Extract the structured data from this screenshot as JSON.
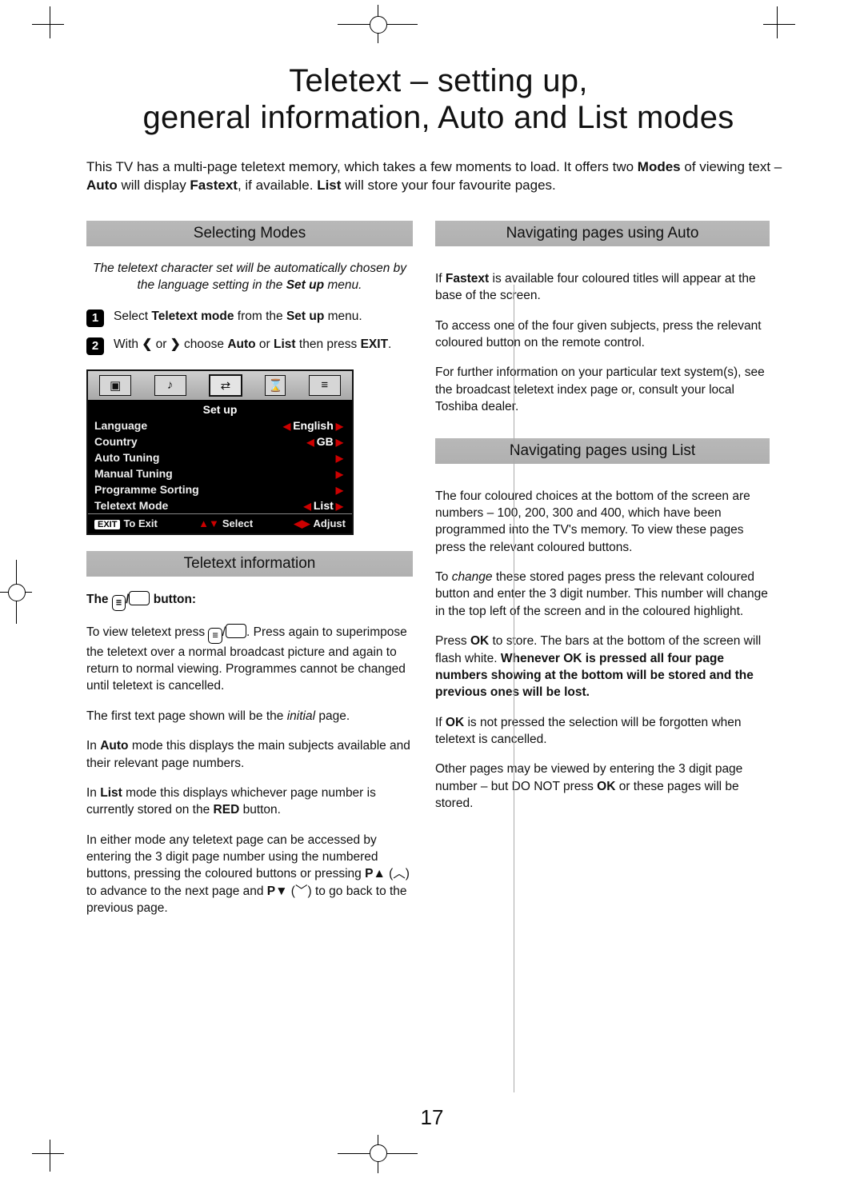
{
  "title_line1": "Teletext – setting up,",
  "title_line2": "general information, Auto and List modes",
  "intro_pre": "This TV has a multi-page teletext memory, which takes a few moments to load. It offers two ",
  "intro_modes_word": "Modes",
  "intro_post": " of viewing text – ",
  "intro_auto": "Auto",
  "intro_mid": " will display ",
  "intro_fastext": "Fastext",
  "intro_after": ", if available. ",
  "intro_list": "List",
  "intro_tail": " will store your four favourite pages.",
  "left": {
    "section1_title": "Selecting Modes",
    "note_pre": "The teletext character set will be automatically chosen by the language setting in the ",
    "note_bold": "Set up",
    "note_post": " menu.",
    "step1_num": "1",
    "step1_pre": "Select ",
    "step1_b1": "Teletext mode",
    "step1_mid": " from the ",
    "step1_b2": "Set up",
    "step1_post": " menu.",
    "step2_num": "2",
    "step2_pre": "With ",
    "step2_mid": " or ",
    "step2_after": " choose ",
    "step2_b1": "Auto",
    "step2_or": " or ",
    "step2_b2": "List",
    "step2_then": " then press ",
    "step2_b3": "EXIT",
    "step2_end": ".",
    "section2_title": "Teletext information",
    "btn_label_pre": "The ",
    "btn_label_post": " button:",
    "p1_pre": "To view teletext press ",
    "p1_post": ". Press again to superimpose the teletext over a normal broadcast picture and again to return to normal viewing. Programmes cannot be changed until teletext is cancelled.",
    "p2_pre": "The first text page shown will be the ",
    "p2_it": "initial",
    "p2_post": " page.",
    "p3_pre": "In ",
    "p3_b": "Auto",
    "p3_post": " mode this displays the main subjects available and their relevant page numbers.",
    "p4_pre": "In ",
    "p4_b": "List",
    "p4_mid": " mode this displays whichever page number is currently stored on the ",
    "p4_b2": "RED",
    "p4_post": " button.",
    "p5_pre": "In either mode any teletext page can be accessed by entering the 3 digit page number using the numbered buttons, pressing the coloured buttons or pressing ",
    "p5_b1": "P",
    "p5_up": "▲",
    "p5_paren1": " (",
    "p5_chevup": "︿",
    "p5_paren1b": ") ",
    "p5_mid": "to advance to the next page and ",
    "p5_b2": "P",
    "p5_dn": "▼",
    "p5_paren2": " (",
    "p5_chedn": "﹀",
    "p5_paren2b": ") ",
    "p5_post": "to go back to the previous page."
  },
  "osd": {
    "title": "Set up",
    "rows": [
      {
        "label": "Language",
        "left_arrow": true,
        "value": "English",
        "right_arrow": true
      },
      {
        "label": "Country",
        "left_arrow": true,
        "value": "GB",
        "right_arrow": true
      },
      {
        "label": "Auto Tuning",
        "left_arrow": false,
        "value": "",
        "right_arrow": true
      },
      {
        "label": "Manual Tuning",
        "left_arrow": false,
        "value": "",
        "right_arrow": true
      },
      {
        "label": "Programme Sorting",
        "left_arrow": false,
        "value": "",
        "right_arrow": true
      },
      {
        "label": "Teletext Mode",
        "left_arrow": true,
        "value": "List",
        "right_arrow": true
      }
    ],
    "footer_exit_badge": "EXIT",
    "footer_exit": "To Exit",
    "footer_select": "Select",
    "footer_adjust": "Adjust"
  },
  "right": {
    "section1_title": "Navigating pages using Auto",
    "a_p1_pre": "If ",
    "a_p1_b": "Fastext",
    "a_p1_post": " is available four coloured titles will appear at the base of the screen.",
    "a_p2": "To access one of the four given subjects, press the relevant coloured button on the remote control.",
    "a_p3": "For further information on your particular text system(s), see the broadcast teletext index page or, consult your local Toshiba dealer.",
    "section2_title": "Navigating pages using List",
    "l_p1": "The four coloured choices at the bottom of the screen are numbers – 100, 200, 300 and 400, which have been programmed into the TV's memory. To view these pages press the relevant coloured buttons.",
    "l_p2_pre": "To ",
    "l_p2_it": "change",
    "l_p2_post": " these stored pages press the relevant coloured button and enter the 3 digit number. This number will change in the top left of the screen and in the coloured highlight.",
    "l_p3_pre": "Press ",
    "l_p3_b1": "OK",
    "l_p3_mid": " to store. The bars at the bottom of the screen will flash white. ",
    "l_p3_b2": "Whenever OK is pressed all four page numbers showing at the bottom will be stored and the previous ones will be lost.",
    "l_p4_pre": "If ",
    "l_p4_b": "OK",
    "l_p4_post": " is not pressed the selection will be forgotten when teletext is cancelled.",
    "l_p5_pre": "Other pages may be viewed by entering the 3 digit page number – but DO NOT press ",
    "l_p5_b": "OK",
    "l_p5_post": " or these pages will be stored."
  },
  "page_number": "17"
}
